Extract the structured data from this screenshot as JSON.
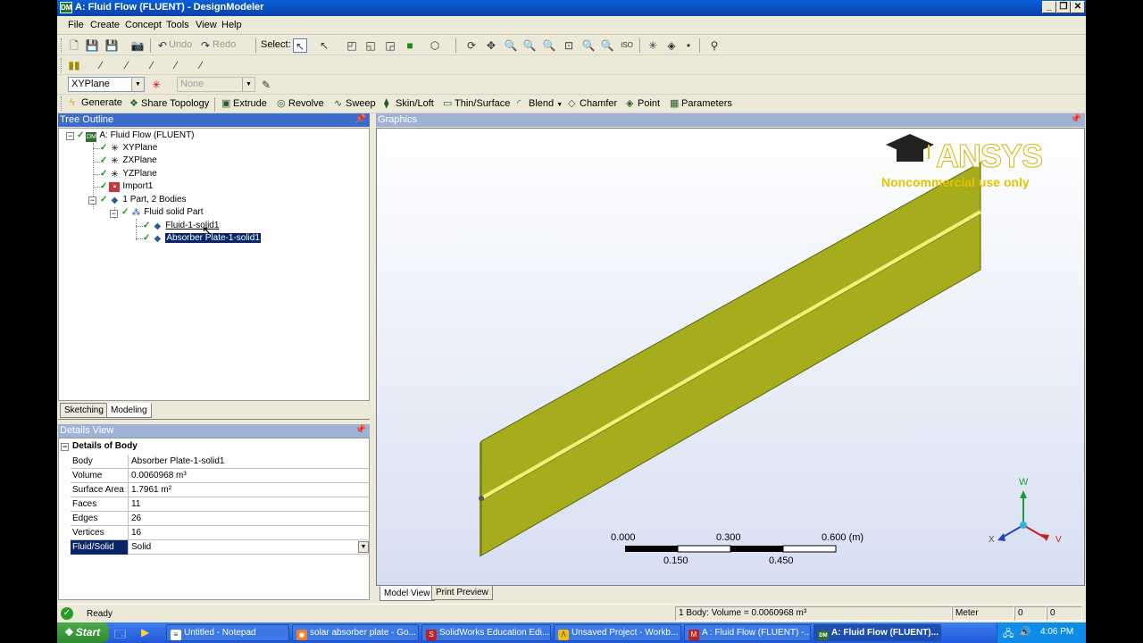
{
  "window": {
    "title": "A: Fluid Flow (FLUENT) - DesignModeler",
    "icon": "DM"
  },
  "menu": [
    "File",
    "Create",
    "Concept",
    "Tools",
    "View",
    "Help"
  ],
  "toolbar1": {
    "undo": "Undo",
    "redo": "Redo",
    "select_label": "Select:"
  },
  "toolbar3": {
    "plane": "XYPlane",
    "sketch": "None"
  },
  "features": {
    "generate": "Generate",
    "share_topology": "Share Topology",
    "extrude": "Extrude",
    "revolve": "Revolve",
    "sweep": "Sweep",
    "skin_loft": "Skin/Loft",
    "thin_surface": "Thin/Surface",
    "blend": "Blend",
    "chamfer": "Chamfer",
    "point": "Point",
    "parameters": "Parameters"
  },
  "tree": {
    "header": "Tree Outline",
    "root": "A: Fluid Flow (FLUENT)",
    "items": [
      "XYPlane",
      "ZXPlane",
      "YZPlane",
      "Import1",
      "1 Part, 2 Bodies",
      "Fluid solid Part",
      "Fluid-1-solid1",
      "Absorber Plate-1-solid1"
    ]
  },
  "tabs": {
    "sketching": "Sketching",
    "modeling": "Modeling"
  },
  "details": {
    "header": "Details View",
    "title": "Details of Body",
    "rows": [
      {
        "key": "Body",
        "value": "Absorber Plate-1-solid1"
      },
      {
        "key": "Volume",
        "value": "0.0060968 m³"
      },
      {
        "key": "Surface Area",
        "value": "1.7961 m²"
      },
      {
        "key": "Faces",
        "value": "11"
      },
      {
        "key": "Edges",
        "value": "26"
      },
      {
        "key": "Vertices",
        "value": "16"
      },
      {
        "key": "Fluid/Solid",
        "value": "Solid"
      }
    ]
  },
  "graphics": {
    "header": "Graphics",
    "brand": "ANSYS",
    "license": "Noncommercial use only",
    "scale_top": [
      "0.000",
      "0.300",
      "0.600 (m)"
    ],
    "scale_bottom": [
      "0.150",
      "0.450"
    ],
    "axes": {
      "w": "W",
      "x": "X",
      "v": "V"
    },
    "view_tabs": [
      "Model View",
      "Print Preview"
    ],
    "colors": {
      "plate": "#a5ad1c",
      "plate_edge": "#5c6210",
      "tube": "#f2f07a"
    }
  },
  "status": {
    "ready": "Ready",
    "selection": "1 Body: Volume = 0.0060968 m³",
    "units": "Meter",
    "f1": "0",
    "f2": "0"
  },
  "taskbar": {
    "start": "Start",
    "buttons": [
      "Untitled - Notepad",
      "solar absorber plate - Go...",
      "SolidWorks Education Edi...",
      "Unsaved Project - Workb...",
      "A : Fluid Flow (FLUENT) -...",
      "A: Fluid Flow (FLUENT)..."
    ],
    "clock": "4:06 PM"
  }
}
